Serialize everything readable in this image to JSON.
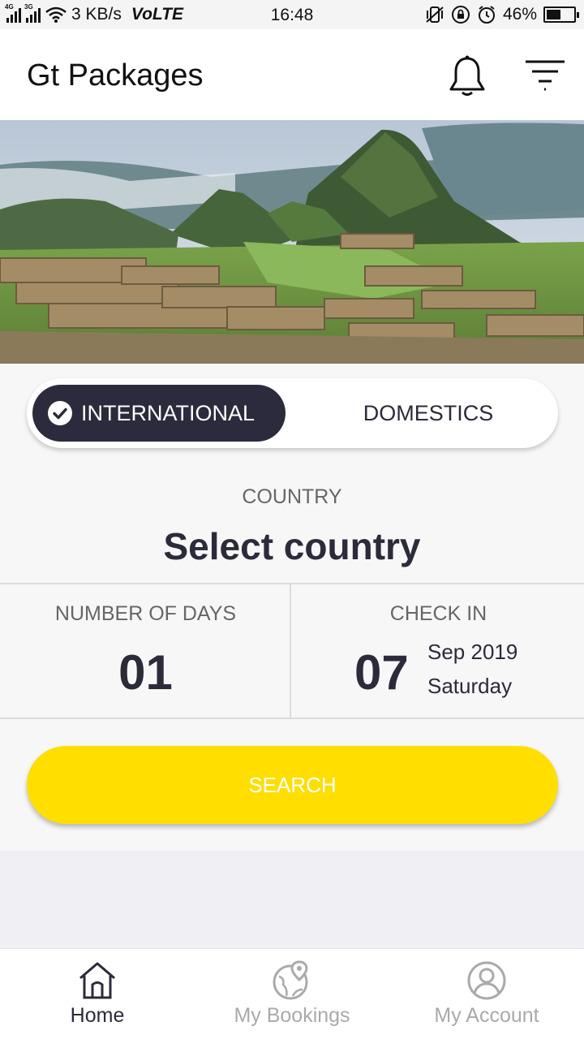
{
  "status_bar": {
    "network_1": "4G",
    "network_2": "3G",
    "speed": "3 KB/s",
    "volte": "VoLTE",
    "time": "16:48",
    "battery": "46%",
    "battery_level": 0.46,
    "icons": [
      "vibrate-icon",
      "lock-rotation-icon",
      "alarm-icon"
    ]
  },
  "header": {
    "title": "Gt Packages",
    "icons": [
      "bell-icon",
      "filter-icon"
    ]
  },
  "hero": {
    "image": "mountain-ruins-landscape"
  },
  "toggle": {
    "international_label": "INTERNATIONAL",
    "domestics_label": "DOMESTICS",
    "selected": "international"
  },
  "country": {
    "label": "COUNTRY",
    "value": "Select country"
  },
  "days": {
    "label": "NUMBER OF DAYS",
    "value": "01"
  },
  "checkin": {
    "label": "CHECK IN",
    "day": "07",
    "month_year": "Sep 2019",
    "weekday": "Saturday"
  },
  "search": {
    "label": "SEARCH"
  },
  "bottom_nav": {
    "items": [
      {
        "label": "Home",
        "icon": "home-icon",
        "active": true
      },
      {
        "label": "My Bookings",
        "icon": "bookings-map-icon",
        "active": false
      },
      {
        "label": "My Account",
        "icon": "account-icon",
        "active": false
      }
    ]
  },
  "colors": {
    "accent": "#ffde00",
    "dark": "#2b2b3d",
    "background": "#efeff4"
  }
}
